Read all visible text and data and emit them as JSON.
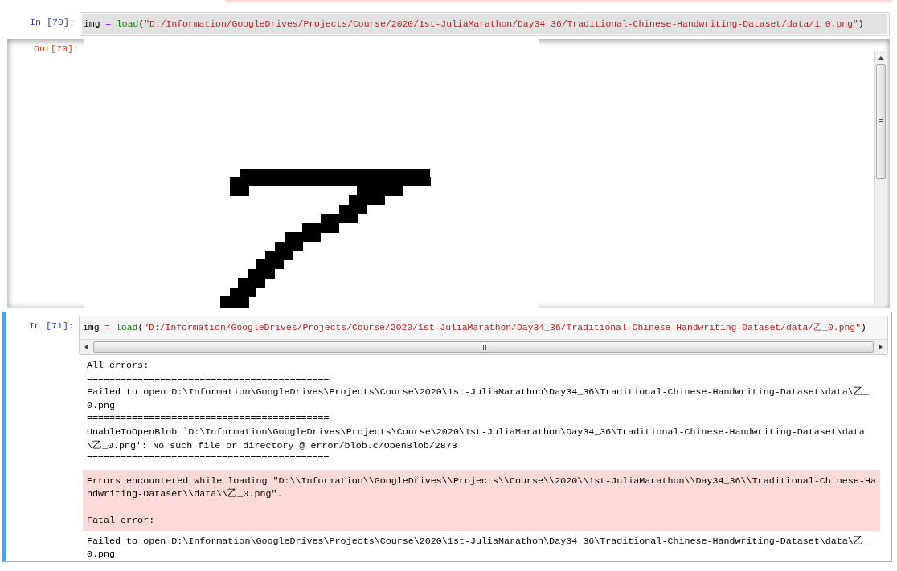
{
  "cells": [
    {
      "prompt": "In [70]:",
      "selected": false,
      "input_scroll": false,
      "code": [
        {
          "kind": "name",
          "text": "img"
        },
        {
          "kind": "op",
          "text": " = "
        },
        {
          "kind": "func",
          "text": "load"
        },
        {
          "kind": "punct",
          "text": "("
        },
        {
          "kind": "string",
          "text": "\"D:/Information/GoogleDrives/Projects/Course/2020/1st-JuliaMarathon/Day34_36/Traditional-Chinese-Handwriting-Dataset/data/1_0.png\""
        },
        {
          "kind": "punct",
          "text": ")"
        }
      ],
      "output": {
        "prompt": "Out[70]:",
        "kind": "image",
        "scrolled": true
      }
    },
    {
      "prompt": "In [71]:",
      "selected": true,
      "input_scroll": true,
      "code": [
        {
          "kind": "name",
          "text": "img"
        },
        {
          "kind": "op",
          "text": " = "
        },
        {
          "kind": "func",
          "text": "load"
        },
        {
          "kind": "punct",
          "text": "("
        },
        {
          "kind": "string",
          "text": "\"D:/Information/GoogleDrives/Projects/Course/2020/1st-JuliaMarathon/Day34_36/Traditional-Chinese-Handwriting-Dataset/data/乙_0.png\""
        },
        {
          "kind": "punct",
          "text": ")"
        }
      ],
      "output": {
        "kind": "stream",
        "blocks": [
          {
            "kind": "plain",
            "text": "All errors:"
          },
          {
            "kind": "plain",
            "text": "==========================================="
          },
          {
            "kind": "plain",
            "text": "Failed to open D:\\Information\\GoogleDrives\\Projects\\Course\\2020\\1st-JuliaMarathon\\Day34_36\\Traditional-Chinese-Handwriting-Dataset\\data\\乙_\n0.png"
          },
          {
            "kind": "plain",
            "text": "==========================================="
          },
          {
            "kind": "plain",
            "text": "UnableToOpenBlob `D:\\Information\\GoogleDrives\\Projects\\Course\\2020\\1st-JuliaMarathon\\Day34_36\\Traditional-Chinese-Handwriting-Dataset\\data\n\\乙_0.png': No such file or directory @ error/blob.c/OpenBlob/2873"
          },
          {
            "kind": "plain",
            "text": "==========================================="
          },
          {
            "kind": "error",
            "lines": [
              "Errors encountered while loading \"D:\\\\Information\\\\GoogleDrives\\\\Projects\\\\Course\\\\2020\\\\1st-JuliaMarathon\\\\Day34_36\\\\Traditional-Chinese-Ha\nndwriting-Dataset\\\\data\\\\乙_0.png\".",
              "Fatal error:"
            ]
          },
          {
            "kind": "plain",
            "text": "Failed to open D:\\Information\\GoogleDrives\\Projects\\Course\\2020\\1st-JuliaMarathon\\Day34_36\\Traditional-Chinese-Handwriting-Dataset\\data\\乙_\n0.png"
          }
        ]
      }
    }
  ]
}
